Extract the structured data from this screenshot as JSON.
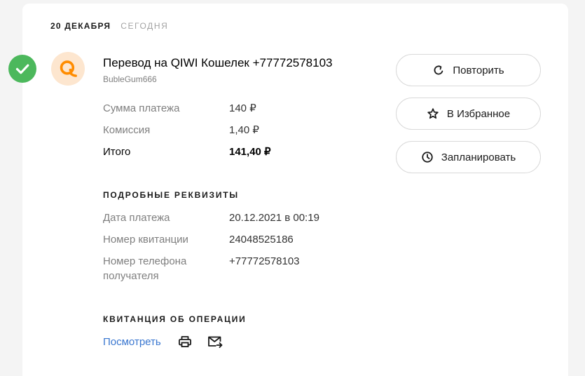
{
  "header": {
    "date": "20 ДЕКАБРЯ",
    "relative_day": "СЕГОДНЯ"
  },
  "status": {
    "icon": "check-icon"
  },
  "provider": {
    "icon": "qiwi-logo-icon"
  },
  "payment": {
    "title": "Перевод на QIWI Кошелек +77772578103",
    "subtitle": "BubleGum666"
  },
  "amounts": [
    {
      "label": "Сумма платежа",
      "value": "140 ₽"
    },
    {
      "label": "Комиссия",
      "value": "1,40 ₽"
    },
    {
      "label": "Итого",
      "value": "141,40 ₽"
    }
  ],
  "details": {
    "heading": "ПОДРОБНЫЕ РЕКВИЗИТЫ",
    "rows": [
      {
        "label": "Дата платежа",
        "value": "20.12.2021 в 00:19"
      },
      {
        "label": "Номер квитанции",
        "value": "24048525186"
      },
      {
        "label": "Номер телефона получателя",
        "value": "+77772578103"
      }
    ]
  },
  "receipt": {
    "heading": "КВИТАНЦИЯ ОБ ОПЕРАЦИИ",
    "view_link": "Посмотреть",
    "print_icon": "printer-icon",
    "send_icon": "mail-forward-icon"
  },
  "actions": [
    {
      "label": "Повторить",
      "icon": "repeat-icon"
    },
    {
      "label": "В Избранное",
      "icon": "star-icon"
    },
    {
      "label": "Запланировать",
      "icon": "clock-icon"
    }
  ],
  "colors": {
    "page_background": "#f4f4f4",
    "card_background": "#ffffff",
    "success": "#4cb85c",
    "provider_background": "#fde6cf",
    "provider_logo": "#ff8c00",
    "link": "#3a77d0",
    "text_primary": "#000000",
    "text_value": "#333333",
    "text_secondary": "#7f7f7f",
    "text_muted": "#a3a3a3",
    "button_border": "#d9d9d9",
    "icon": "#1a1a1a"
  }
}
